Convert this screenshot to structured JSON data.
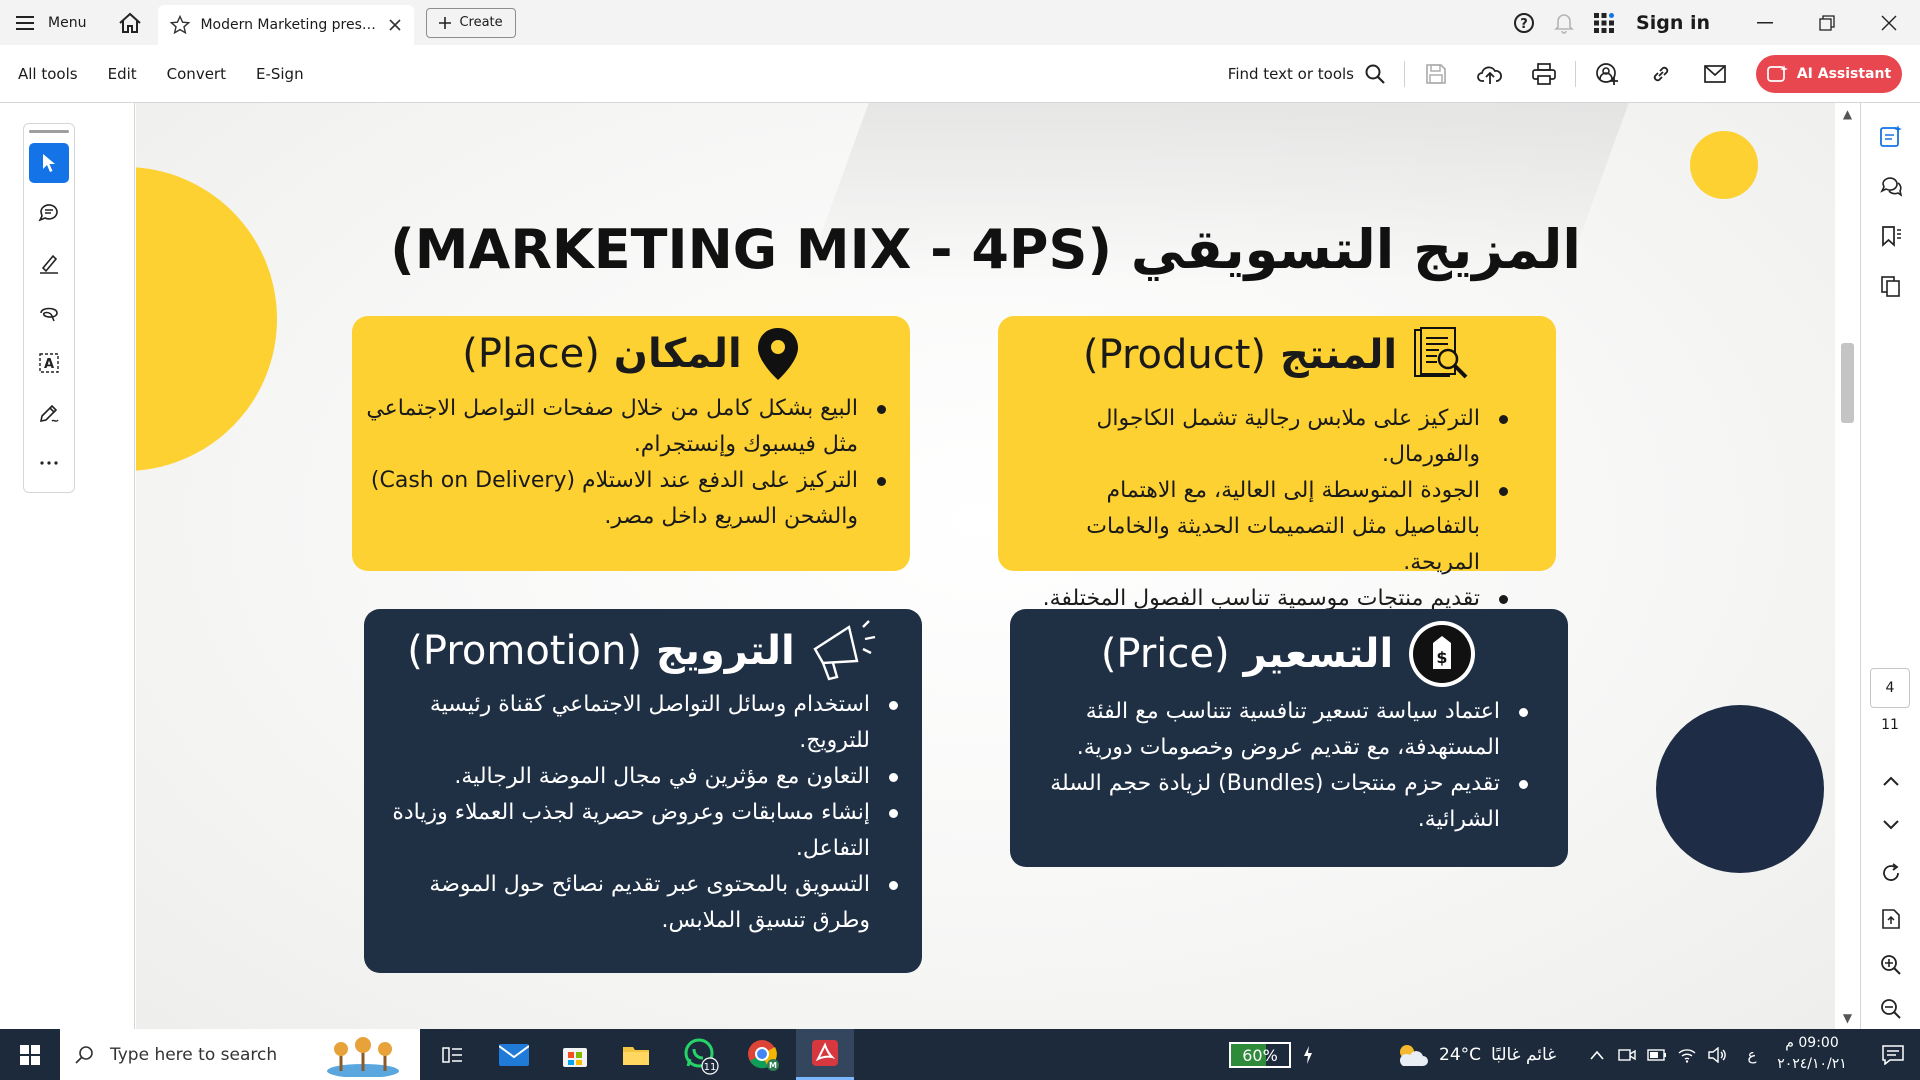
{
  "titlebar": {
    "menu_label": "Menu",
    "tab_title": "Modern Marketing prese...",
    "create_label": "Create",
    "sign_in": "Sign in"
  },
  "toolbar": {
    "menus": [
      "All tools",
      "Edit",
      "Convert",
      "E-Sign"
    ],
    "find_text": "Find text or tools",
    "ai_assistant": "AI Assistant"
  },
  "slide": {
    "title": "المزيج التسويقي (MARKETING MIX - 4PS)",
    "colors": {
      "yellow": "#fdd131",
      "navy": "#1f3045"
    },
    "product": {
      "heading_ar": "المنتج",
      "heading_en": "(Product)",
      "items": [
        "التركيز على ملابس رجالية تشمل الكاجوال والفورمال.",
        "الجودة المتوسطة إلى العالية، مع الاهتمام بالتفاصيل مثل التصميمات الحديثة والخامات المريحة.",
        "تقديم منتجات موسمية تناسب الفصول المختلفة."
      ]
    },
    "place": {
      "heading_ar": "المكان",
      "heading_en": "(Place)",
      "items": [
        "البيع بشكل كامل من خلال صفحات التواصل الاجتماعي مثل فيسبوك وإنستجرام.",
        "التركيز على الدفع عند الاستلام (Cash on Delivery) والشحن السريع داخل مصر."
      ]
    },
    "price": {
      "heading_ar": "التسعير",
      "heading_en": "(Price)",
      "items": [
        "اعتماد سياسة تسعير تنافسية تتناسب مع الفئة المستهدفة، مع تقديم عروض وخصومات دورية.",
        "تقديم حزم منتجات (Bundles) لزيادة حجم السلة الشرائية."
      ]
    },
    "promotion": {
      "heading_ar": "الترويج",
      "heading_en": "(Promotion)",
      "items": [
        "استخدام وسائل التواصل الاجتماعي كقناة رئيسية للترويج.",
        "التعاون مع مؤثرين في مجال الموضة الرجالية.",
        "إنشاء مسابقات وعروض حصرية لجذب العملاء وزيادة التفاعل.",
        "التسويق بالمحتوى عبر تقديم نصائح حول الموضة وطرق تنسيق الملابس."
      ]
    }
  },
  "right_panel": {
    "current_page": "4",
    "total_pages": "11"
  },
  "taskbar": {
    "search_placeholder": "Type here to search",
    "whatsapp_badge": "11",
    "battery_percent": "60%",
    "battery_level": 0.6,
    "temperature": "24°C",
    "weather_text": "غائم غالبًا",
    "language": "ع",
    "time": "09:00 م",
    "date": "٢٠٢٤/١٠/٢١"
  }
}
